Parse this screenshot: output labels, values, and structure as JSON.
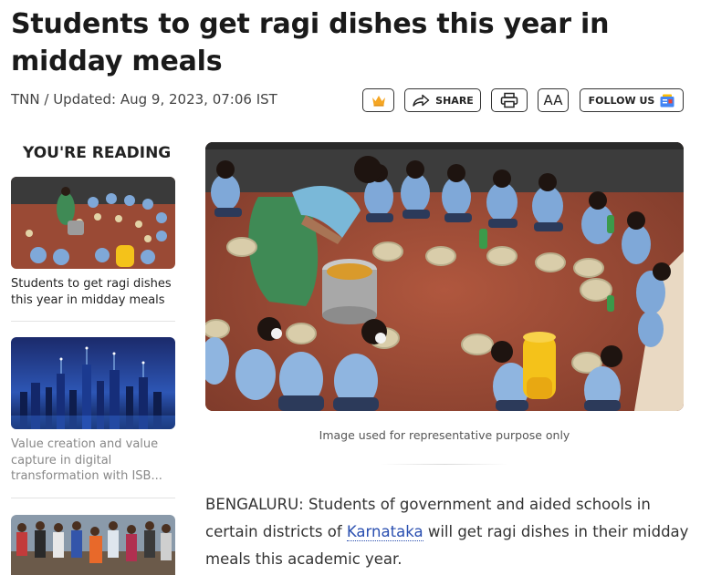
{
  "article": {
    "headline": "Students to get ragi dishes this year in midday meals",
    "byline": "TNN / Updated: Aug 9, 2023, 07:06 IST",
    "image_caption": "Image used for representative purpose only",
    "body_prefix": "BENGALURU: Students of government and aided schools in certain districts of ",
    "body_link": "Karnataka",
    "body_suffix": " will get ragi dishes in their midday meals this academic year."
  },
  "toolbar": {
    "share_label": "SHARE",
    "font_size_label": "AA",
    "follow_label": "FOLLOW US"
  },
  "sidebar": {
    "title": "YOU'RE READING",
    "items": [
      {
        "title": "Students to get ragi dishes this year in midday meals",
        "color": "#222222"
      },
      {
        "title": "Value creation and value capture in digital transformation with ISB...",
        "color": "#888888"
      },
      {
        "title": "",
        "color": "#888888"
      }
    ]
  },
  "icons": {
    "crown": "crown-icon",
    "share": "share-arrow-icon",
    "print": "printer-icon",
    "google_news": "google-news-icon"
  },
  "colors": {
    "crown": "#f5a623",
    "link": "#2a4fb0",
    "uniform": "#7fa8d8",
    "floor": "#9a4a35"
  }
}
